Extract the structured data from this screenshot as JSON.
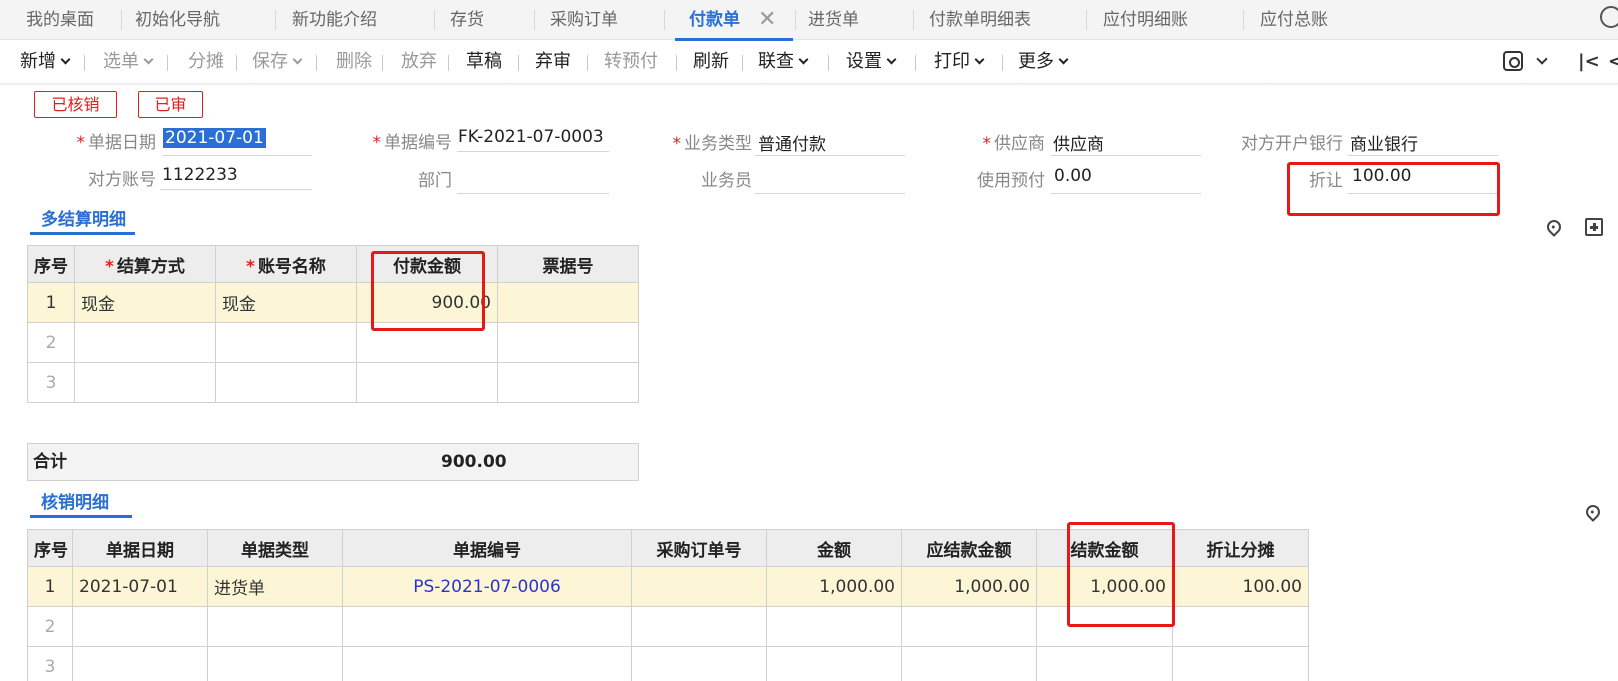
{
  "tabs": [
    {
      "label": "我的桌面"
    },
    {
      "label": "初始化导航"
    },
    {
      "label": "新功能介绍"
    },
    {
      "label": "存货"
    },
    {
      "label": "采购订单"
    },
    {
      "label": "付款单"
    },
    {
      "label": "进货单"
    },
    {
      "label": "付款单明细表"
    },
    {
      "label": "应付明细账"
    },
    {
      "label": "应付总账"
    }
  ],
  "tab_close_glyph": "✕",
  "toolbar": {
    "new": "新增",
    "select": "选单",
    "split": "分摊",
    "save": "保存",
    "delete": "删除",
    "discard": "放弃",
    "draft": "草稿",
    "unaudit": "弃审",
    "to_prepay": "转预付",
    "refresh": "刷新",
    "linked_query": "联查",
    "settings": "设置",
    "print": "打印",
    "more": "更多"
  },
  "status_tags": [
    "已核销",
    "已审"
  ],
  "form": {
    "doc_date": {
      "label": "单据日期",
      "value": "2021-07-01"
    },
    "doc_no": {
      "label": "单据编号",
      "value": "FK-2021-07-0003"
    },
    "biz_type": {
      "label": "业务类型",
      "value": "普通付款"
    },
    "supplier": {
      "label": "供应商",
      "value": "供应商"
    },
    "bank": {
      "label": "对方开户银行",
      "value": "商业银行"
    },
    "account_no": {
      "label": "对方账号",
      "value": "1122233"
    },
    "dept": {
      "label": "部门",
      "value": ""
    },
    "salesman": {
      "label": "业务员",
      "value": ""
    },
    "use_prepay": {
      "label": "使用预付",
      "value": "0.00"
    },
    "discount": {
      "label": "折让",
      "value": "100.00"
    }
  },
  "settlement": {
    "title": "多结算明细",
    "headers": [
      "序号",
      "结算方式",
      "账号名称",
      "付款金额",
      "票据号"
    ],
    "rows": [
      {
        "no": "1",
        "method": "现金",
        "account": "现金",
        "amount": "900.00",
        "bill": ""
      },
      {
        "no": "2",
        "method": "",
        "account": "",
        "amount": "",
        "bill": ""
      },
      {
        "no": "3",
        "method": "",
        "account": "",
        "amount": "",
        "bill": ""
      }
    ],
    "total_label": "合计",
    "total_value": "900.00"
  },
  "writeoff": {
    "title": "核销明细",
    "headers": [
      "序号",
      "单据日期",
      "单据类型",
      "单据编号",
      "采购订单号",
      "金额",
      "应结款金额",
      "结款金额",
      "折让分摊"
    ],
    "rows": [
      {
        "no": "1",
        "date": "2021-07-01",
        "type": "进货单",
        "doc_no": "PS-2021-07-0006",
        "po_no": "",
        "amount": "1,000.00",
        "due": "1,000.00",
        "settled": "1,000.00",
        "discount": "100.00"
      },
      {
        "no": "2",
        "date": "",
        "type": "",
        "doc_no": "",
        "po_no": "",
        "amount": "",
        "due": "",
        "settled": "",
        "discount": ""
      },
      {
        "no": "3",
        "date": "",
        "type": "",
        "doc_no": "",
        "po_no": "",
        "amount": "",
        "due": "",
        "settled": "",
        "discount": ""
      }
    ]
  },
  "colors": {
    "accent": "#2a6fd6",
    "annotation": "#e81818",
    "selected_row": "#fdf6d6",
    "link": "#2a35c8"
  }
}
